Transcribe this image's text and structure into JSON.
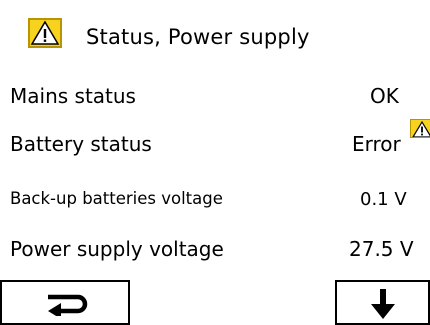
{
  "header": {
    "title": "Status, Power supply",
    "icon": "warning-triangle-icon"
  },
  "rows": [
    {
      "label": "Mains status",
      "value": "OK"
    },
    {
      "label": "Battery status",
      "value": "Error",
      "icon": "warning-triangle-icon"
    },
    {
      "label": "Back-up batteries voltage",
      "value": "0.1 V"
    },
    {
      "label": "Power supply voltage",
      "value": "27.5 V"
    }
  ],
  "footer": {
    "back_button_icon": "return-arrow-icon",
    "next_button_icon": "down-arrow-icon"
  },
  "colors": {
    "warning": "#f7d21e",
    "foreground": "#000000",
    "background": "#ffffff"
  }
}
